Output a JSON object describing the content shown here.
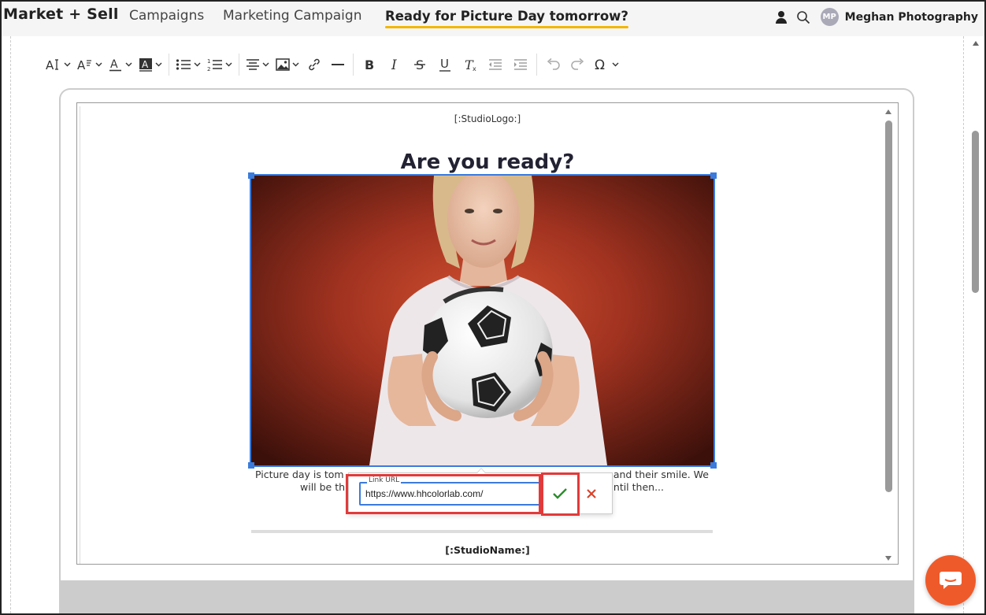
{
  "app": {
    "brand": "Market + Sell",
    "breadcrumbs": [
      "Campaigns",
      "Marketing Campaign",
      "Ready for Picture Day tomorrow?"
    ],
    "account": {
      "initials": "MP",
      "name": "Meghan Photography"
    },
    "accent_color": "#f2b705"
  },
  "toolbar": {
    "buttons": [
      {
        "icon": "font-size-icon",
        "dropdown": true
      },
      {
        "icon": "font-family-icon",
        "dropdown": true
      },
      {
        "icon": "text-color-icon",
        "dropdown": true
      },
      {
        "icon": "highlight-color-icon",
        "dropdown": true
      },
      {
        "icon": "bulleted-list-icon",
        "dropdown": true
      },
      {
        "icon": "numbered-list-icon",
        "dropdown": true
      },
      {
        "icon": "align-icon",
        "dropdown": true
      },
      {
        "icon": "image-icon",
        "dropdown": true
      },
      {
        "icon": "link-icon",
        "dropdown": false
      },
      {
        "icon": "horizontal-rule-icon",
        "dropdown": false
      },
      {
        "icon": "bold-icon",
        "dropdown": false
      },
      {
        "icon": "italic-icon",
        "dropdown": false
      },
      {
        "icon": "strikethrough-icon",
        "dropdown": false
      },
      {
        "icon": "underline-icon",
        "dropdown": false
      },
      {
        "icon": "clear-format-icon",
        "dropdown": false
      },
      {
        "icon": "outdent-icon",
        "dropdown": false
      },
      {
        "icon": "indent-icon",
        "dropdown": false
      },
      {
        "icon": "undo-icon",
        "dropdown": false
      },
      {
        "icon": "redo-icon",
        "dropdown": false
      },
      {
        "icon": "special-character-icon",
        "dropdown": true
      }
    ]
  },
  "email": {
    "logo_placeholder": "[:StudioLogo:]",
    "headline": "Are you ready?",
    "hero_image_alt": "Woman in white t-shirt holding a soccer ball against a red background",
    "body_line1_left": "Picture day is tom",
    "body_line1_right": "and their smile. We",
    "body_line2_left": "will be th",
    "body_line2_right": "ntil then...",
    "studio_name_placeholder": "[:StudioName:]"
  },
  "link_popover": {
    "label": "Link URL",
    "value": "https://www.hhcolorlab.com/",
    "confirm_icon": "check-icon",
    "cancel_icon": "close-icon",
    "confirm_color": "#2e8b2e",
    "cancel_color": "#d9442a"
  },
  "chat": {
    "icon": "chat-icon",
    "color": "#ef5a2a"
  }
}
